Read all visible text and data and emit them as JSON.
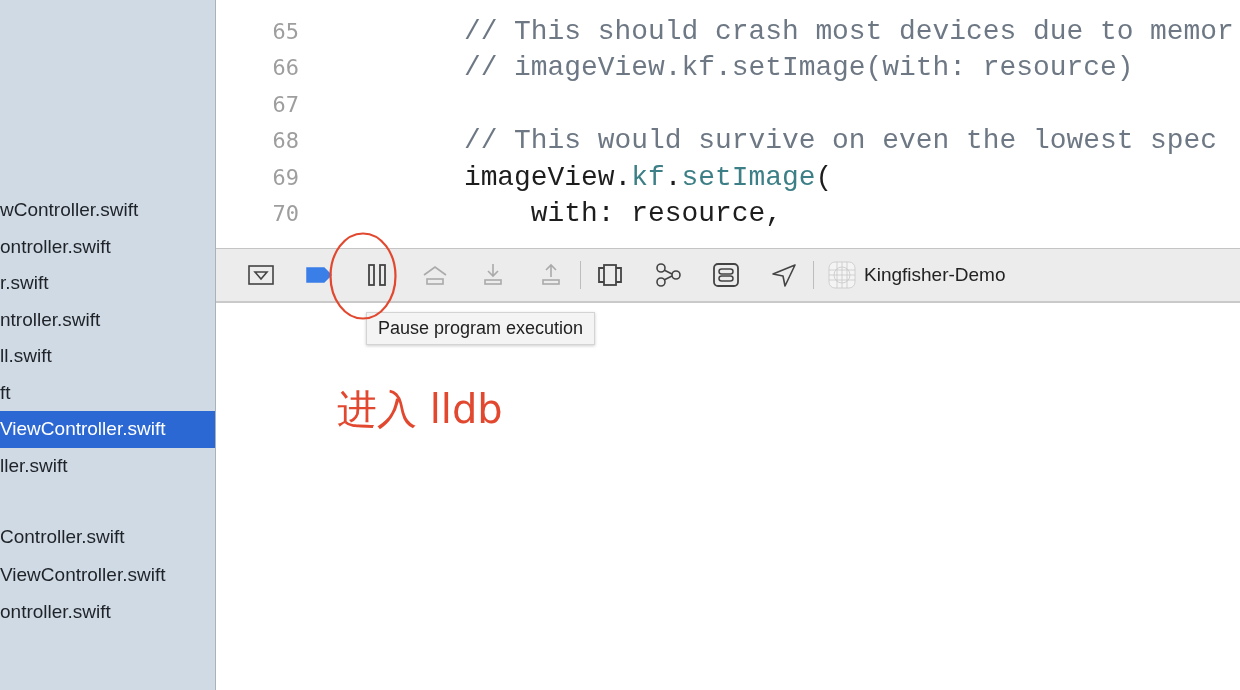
{
  "sidebar": {
    "items": [
      {
        "name": "wController.swift",
        "selected": false,
        "gap_before": false
      },
      {
        "name": "ontroller.swift",
        "selected": false,
        "gap_before": false
      },
      {
        "name": "r.swift",
        "selected": false,
        "gap_before": false
      },
      {
        "name": "ntroller.swift",
        "selected": false,
        "gap_before": false
      },
      {
        "name": "ll.swift",
        "selected": false,
        "gap_before": false
      },
      {
        "name": "ft",
        "selected": false,
        "gap_before": false
      },
      {
        "name": "ViewController.swift",
        "selected": true,
        "gap_before": false
      },
      {
        "name": "ller.swift",
        "selected": false,
        "gap_before": false
      },
      {
        "name": "Controller.swift",
        "selected": false,
        "gap_before": true
      },
      {
        "name": "ViewController.swift",
        "selected": false,
        "gap_before": false
      },
      {
        "name": "ontroller.swift",
        "selected": false,
        "gap_before": false
      }
    ]
  },
  "editor": {
    "lines": [
      {
        "number": "65",
        "tokens": [
          {
            "kind": "comment",
            "text": "        // This should crash most devices due to memor"
          }
        ]
      },
      {
        "number": "66",
        "tokens": [
          {
            "kind": "comment",
            "text": "        // imageView.kf.setImage(with: resource)"
          }
        ]
      },
      {
        "number": "67"
      },
      {
        "number": "68",
        "tokens": [
          {
            "kind": "comment",
            "text": "        // This would survive on even the lowest spec"
          }
        ]
      },
      {
        "number": "69",
        "tokens": [
          {
            "kind": "plain",
            "text": "        imageView."
          },
          {
            "kind": "member",
            "text": "kf"
          },
          {
            "kind": "plain",
            "text": "."
          },
          {
            "kind": "member",
            "text": "setImage"
          },
          {
            "kind": "plain",
            "text": "("
          }
        ]
      },
      {
        "number": "70",
        "tokens": [
          {
            "kind": "plain",
            "text": "            with: resource,"
          }
        ]
      }
    ]
  },
  "debug_bar": {
    "items": [
      {
        "kind": "console-toggle",
        "disabled": false
      },
      {
        "kind": "breakpoints",
        "disabled": false,
        "on": true
      },
      {
        "kind": "pause",
        "disabled": false
      },
      {
        "kind": "step-over",
        "disabled": true
      },
      {
        "kind": "step-into",
        "disabled": true
      },
      {
        "kind": "step-out",
        "disabled": true
      },
      {
        "kind": "separator"
      },
      {
        "kind": "view-debugger",
        "disabled": false
      },
      {
        "kind": "memory-graph",
        "disabled": false
      },
      {
        "kind": "environment",
        "disabled": false
      },
      {
        "kind": "location",
        "disabled": false
      },
      {
        "kind": "separator"
      },
      {
        "kind": "scheme",
        "label": "Kingfisher-Demo"
      }
    ]
  },
  "tooltip": {
    "text": "Pause program execution"
  },
  "annotation": {
    "text": "进入 lldb"
  }
}
